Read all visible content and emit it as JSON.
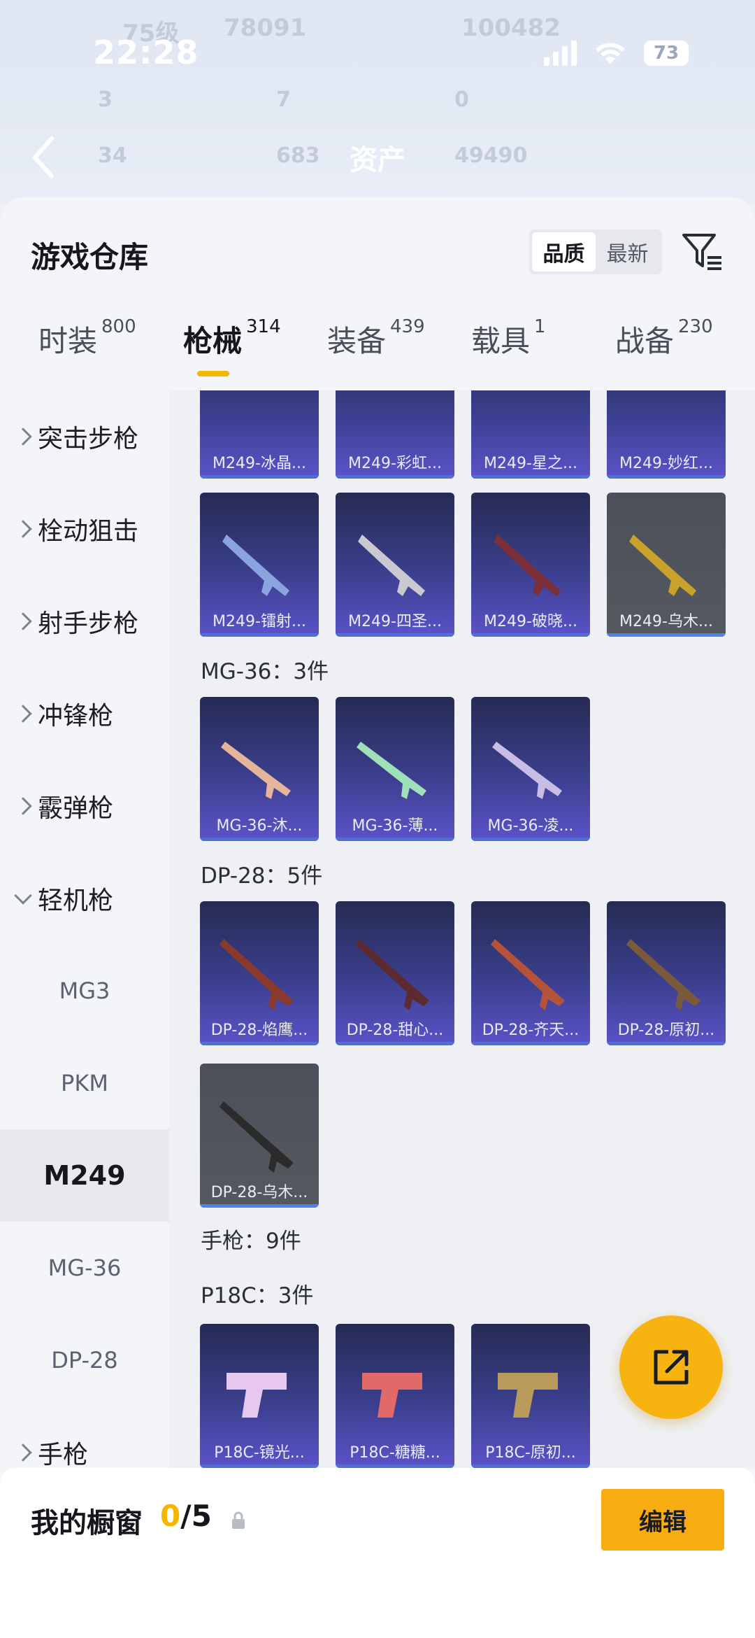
{
  "status": {
    "time": "22:28",
    "battery": "73"
  },
  "header": {
    "title": "资产",
    "ghost": {
      "level": "75级",
      "coins": "78091",
      "score": "100482",
      "v1": "3",
      "v2": "7",
      "v3": "0",
      "v4": "34",
      "v5": "683",
      "v6": "49490"
    }
  },
  "sheet": {
    "title": "游戏仓库",
    "sort": [
      "品质",
      "最新"
    ]
  },
  "tabs": [
    {
      "label": "时装",
      "count": "800"
    },
    {
      "label": "枪械",
      "count": "314"
    },
    {
      "label": "装备",
      "count": "439"
    },
    {
      "label": "载具",
      "count": "1"
    },
    {
      "label": "战备",
      "count": "230"
    }
  ],
  "categories": [
    "突击步枪",
    "栓动狙击",
    "射手步枪",
    "冲锋枪",
    "霰弹枪",
    "轻机枪",
    "MG3",
    "PKM",
    "M249",
    "MG-36",
    "DP-28",
    "手枪"
  ],
  "sections": {
    "mg36": "MG-36：3件",
    "dp28": "DP-28：5件",
    "pistol": "手枪：9件",
    "p18c": "P18C：3件"
  },
  "items": {
    "row0": [
      "M249-冰晶...",
      "M249-彩虹...",
      "M249-星之...",
      "M249-妙红..."
    ],
    "row1": [
      "M249-镭射...",
      "M249-四圣...",
      "M249-破晓...",
      "M249-乌木..."
    ],
    "mg36": [
      "MG-36-沐...",
      "MG-36-薄...",
      "MG-36-凌..."
    ],
    "dp28a": [
      "DP-28-焰鹰...",
      "DP-28-甜心...",
      "DP-28-齐天...",
      "DP-28-原初..."
    ],
    "dp28b": [
      "DP-28-乌木..."
    ],
    "p18c": [
      "P18C-镜光...",
      "P18C-糖糖...",
      "P18C-原初..."
    ]
  },
  "bottom": {
    "label": "我的橱窗",
    "current": "0",
    "total": "/5",
    "edit": "编辑"
  },
  "colors": {
    "accent": "#f6b500",
    "card": "#3b3f8d",
    "gray_card": "#4b4f59"
  }
}
